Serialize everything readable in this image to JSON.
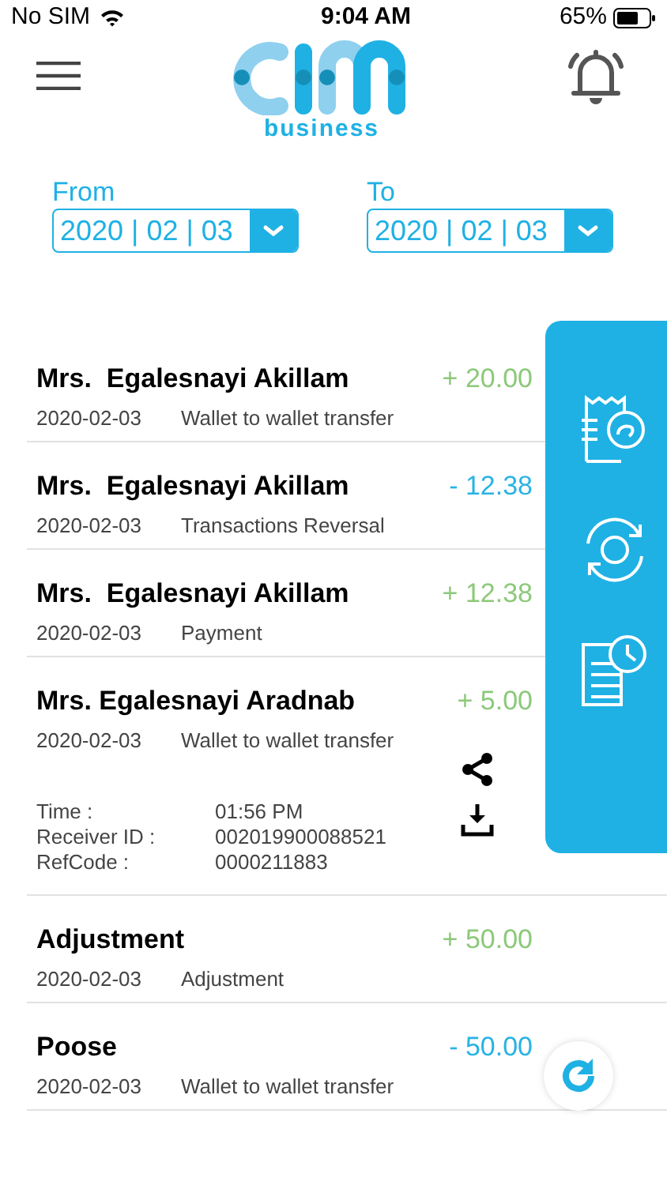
{
  "status_bar": {
    "carrier": "No SIM",
    "time": "9:04 AM",
    "battery": "65%"
  },
  "brand": {
    "subtitle": "business"
  },
  "filters": [
    {
      "label": "From",
      "value": "2020 | 02 | 03"
    },
    {
      "label": "To",
      "value": "2020 | 02 | 03"
    }
  ],
  "transactions": [
    {
      "name": "Mrs.  Egalesnayi Akillam",
      "date": "2020-02-03",
      "description": "Wallet to wallet transfer",
      "amount": "+ 20.00",
      "color": "#8cc97a"
    },
    {
      "name": "Mrs.  Egalesnayi Akillam",
      "date": "2020-02-03",
      "description": "Transactions Reversal",
      "amount": "- 12.38",
      "color": "#29b3e3"
    },
    {
      "name": "Mrs.  Egalesnayi Akillam",
      "date": "2020-02-03",
      "description": "Payment",
      "amount": "+ 12.38",
      "color": "#8cc97a"
    },
    {
      "name": "Mrs. Egalesnayi Aradnab",
      "date": "2020-02-03",
      "description": "Wallet to wallet transfer",
      "amount": "+ 5.00",
      "color": "#8cc97a",
      "details": [
        {
          "label": "Time :",
          "value": "01:56 PM"
        },
        {
          "label": "Receiver ID :",
          "value": "002019900088521"
        },
        {
          "label": "RefCode :",
          "value": "0000211883"
        }
      ]
    },
    {
      "name": "Adjustment",
      "date": "2020-02-03",
      "description": "Adjustment",
      "amount": "+ 50.00",
      "color": "#8cc97a"
    },
    {
      "name": "Poose",
      "date": "2020-02-03",
      "description": "Wallet to wallet transfer",
      "amount": "- 50.00",
      "color": "#29b3e3"
    }
  ]
}
